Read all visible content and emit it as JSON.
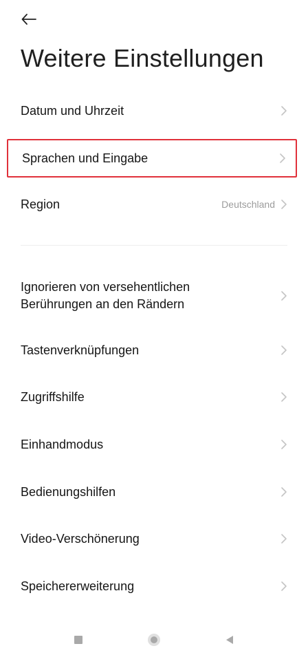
{
  "header": {
    "back_icon": "arrow-left-icon",
    "title": "Weitere Einstellungen"
  },
  "group1": {
    "items": [
      {
        "label": "Datum und Uhrzeit"
      },
      {
        "label": "Sprachen und Eingabe",
        "highlighted": true
      },
      {
        "label": "Region",
        "value": "Deutschland"
      }
    ]
  },
  "group2": {
    "items": [
      {
        "label_line1": "Ignorieren von versehentlichen",
        "label_line2": "Berührungen an den Rändern"
      },
      {
        "label": "Tastenverknüpfungen"
      },
      {
        "label": "Zugriffshilfe"
      },
      {
        "label": "Einhandmodus"
      },
      {
        "label": "Bedienungshilfen"
      },
      {
        "label": "Video-Verschönerung"
      },
      {
        "label": "Speichererweiterung"
      }
    ]
  },
  "navbar": {
    "recents_icon": "square-icon",
    "home_icon": "circle-icon",
    "back_icon": "triangle-left-icon"
  },
  "colors": {
    "highlight_border": "#e0303a",
    "chevron": "#c4c4c4",
    "value_text": "#9c9c9c"
  }
}
